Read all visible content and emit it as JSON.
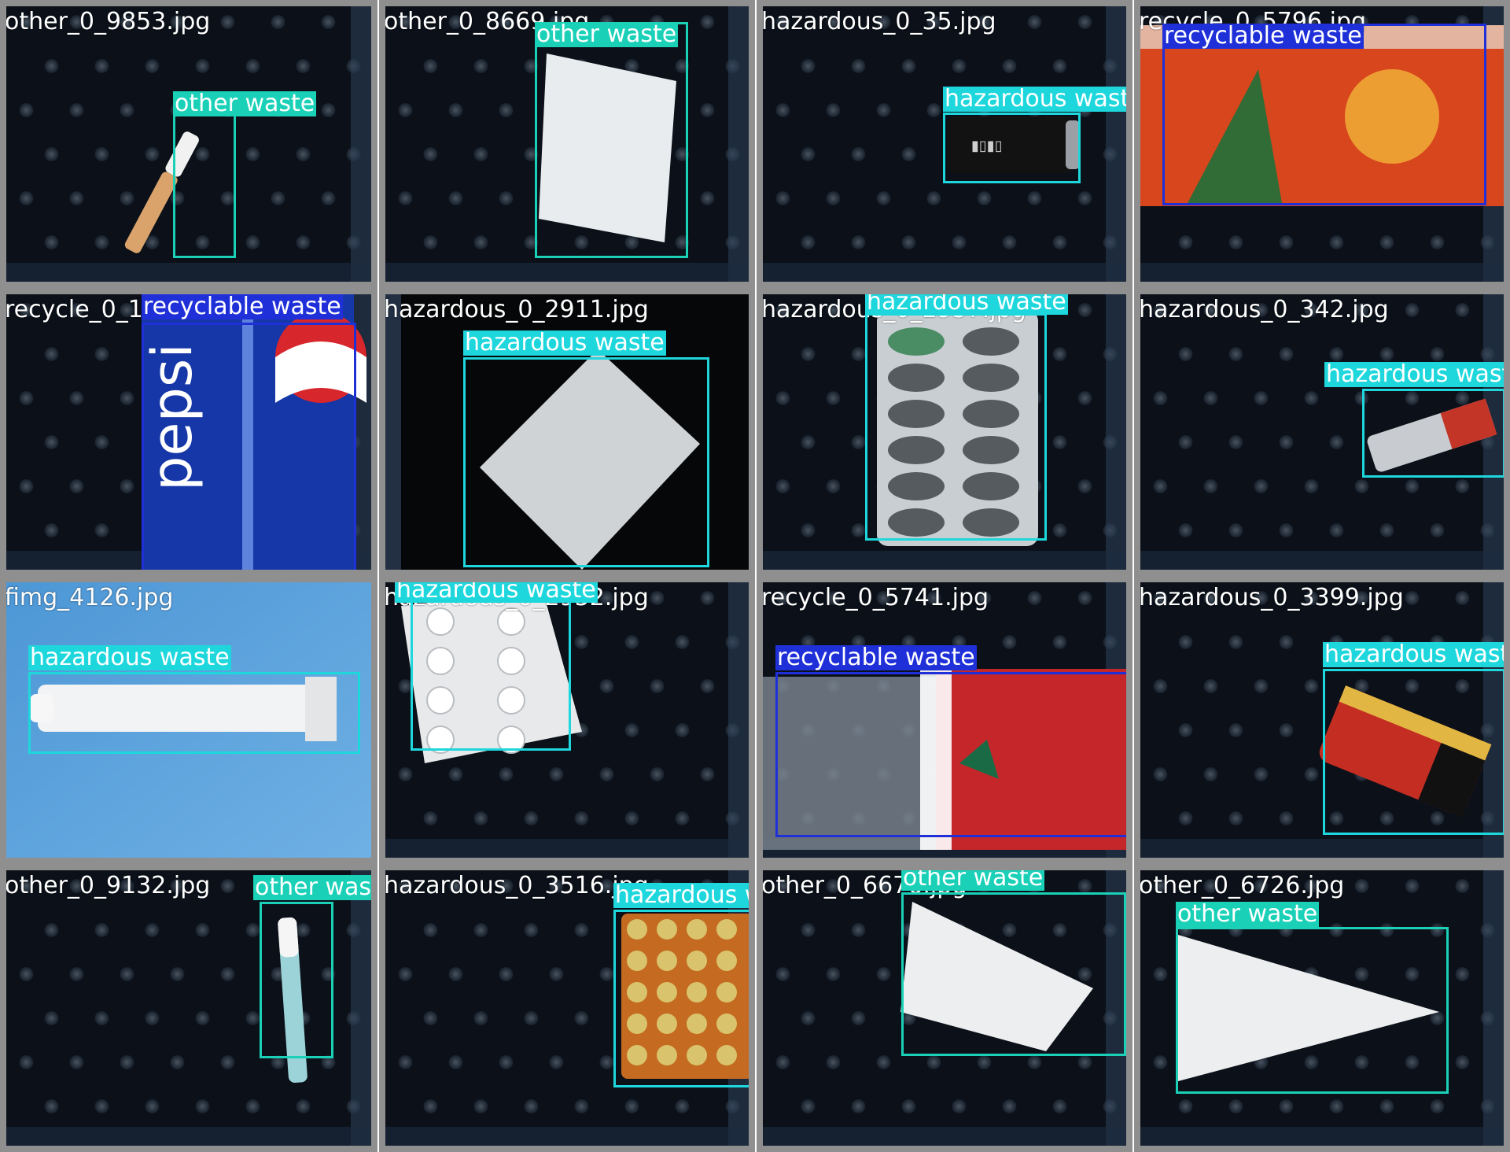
{
  "colors": {
    "other waste": "#1ad1b8",
    "hazardous waste": "#1ed7dd",
    "recyclable waste": "#1f30d9",
    "tile_border": "#8f8f8f"
  },
  "tiles": [
    {
      "filename": "other_0_9853.jpg",
      "scene": "mat-dark",
      "object": "cigarette-image",
      "detections": [
        {
          "label": "other waste"
        }
      ]
    },
    {
      "filename": "other_0_8669.jpg",
      "scene": "mat-dark",
      "object": "paper-image",
      "detections": [
        {
          "label": "other waste"
        }
      ]
    },
    {
      "filename": "hazardous_0_35.jpg",
      "scene": "mat-dark",
      "object": "battery-image",
      "detections": [
        {
          "label": "hazardous waste"
        }
      ]
    },
    {
      "filename": "recycle_0_5796.jpg",
      "scene": "mat-dark",
      "object": "can-orange-image",
      "detections": [
        {
          "label": "recyclable waste"
        }
      ]
    },
    {
      "filename": "recycle_0_1",
      "scene": "mat-dark",
      "object": "can-blue-image",
      "detections": [
        {
          "label": "recyclable waste"
        }
      ]
    },
    {
      "filename": "hazardous_0_2911.jpg",
      "scene": "black",
      "object": "blister-foil-image",
      "detections": [
        {
          "label": "hazardous waste"
        }
      ]
    },
    {
      "filename": "hazardous_0_2957.jpg",
      "scene": "mat-dark",
      "object": "capsule-blister-image",
      "detections": [
        {
          "label": "hazardous waste"
        }
      ]
    },
    {
      "filename": "hazardous_0_342.jpg",
      "scene": "mat-dark",
      "object": "battery-small-image",
      "detections": [
        {
          "label": "hazardous waste"
        }
      ]
    },
    {
      "filename": "fimg_4126.jpg",
      "scene": "blue",
      "object": "ointment-tube-image",
      "detections": [
        {
          "label": "hazardous waste"
        }
      ]
    },
    {
      "filename": "hazardous_0_2952.jpg",
      "scene": "mat-dark",
      "object": "pill-blister-image",
      "detections": [
        {
          "label": "hazardous waste"
        }
      ]
    },
    {
      "filename": "recycle_0_5741.jpg",
      "scene": "mat-dark",
      "object": "bottle-image",
      "detections": [
        {
          "label": "recyclable waste"
        }
      ]
    },
    {
      "filename": "hazardous_0_3399.jpg",
      "scene": "mat-dark",
      "object": "battery-large-image",
      "detections": [
        {
          "label": "hazardous waste"
        }
      ]
    },
    {
      "filename": "other_0_9132.jpg",
      "scene": "mat-dark",
      "object": "lipstick-tube-image",
      "detections": [
        {
          "label": "other waste"
        }
      ]
    },
    {
      "filename": "hazardous_0_3516.jpg",
      "scene": "mat-dark",
      "object": "orange-blister-image",
      "detections": [
        {
          "label": "hazardous waste"
        }
      ]
    },
    {
      "filename": "other_0_6676.jpg",
      "scene": "mat-dark",
      "object": "paper-image",
      "detections": [
        {
          "label": "other waste"
        }
      ]
    },
    {
      "filename": "other_0_6726.jpg",
      "scene": "mat-dark",
      "object": "paper-triangle-image",
      "detections": [
        {
          "label": "other waste"
        }
      ]
    }
  ]
}
